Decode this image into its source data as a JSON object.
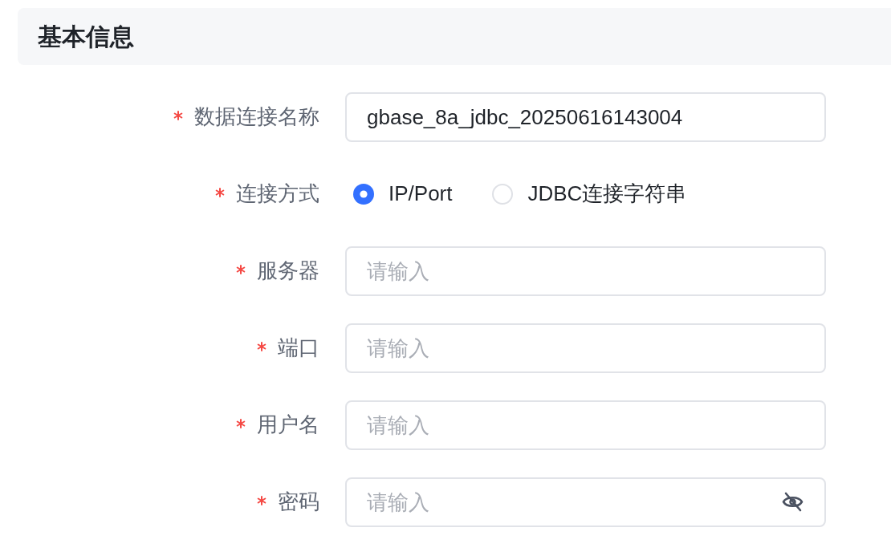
{
  "section": {
    "title": "基本信息"
  },
  "form": {
    "fields": [
      {
        "kind": "text",
        "label": "数据连接名称",
        "required": true,
        "value": "gbase_8a_jdbc_20250616143004"
      },
      {
        "kind": "radio",
        "label": "连接方式",
        "required": true,
        "options": [
          {
            "label": "IP/Port",
            "selected": true
          },
          {
            "label": "JDBC连接字符串",
            "selected": false
          }
        ]
      },
      {
        "kind": "text",
        "label": "服务器",
        "required": true,
        "placeholder": "请输入"
      },
      {
        "kind": "text",
        "label": "端口",
        "required": true,
        "placeholder": "请输入"
      },
      {
        "kind": "text",
        "label": "用户名",
        "required": true,
        "placeholder": "请输入"
      },
      {
        "kind": "password",
        "label": "密码",
        "required": true,
        "placeholder": "请输入",
        "visible": false
      }
    ]
  }
}
